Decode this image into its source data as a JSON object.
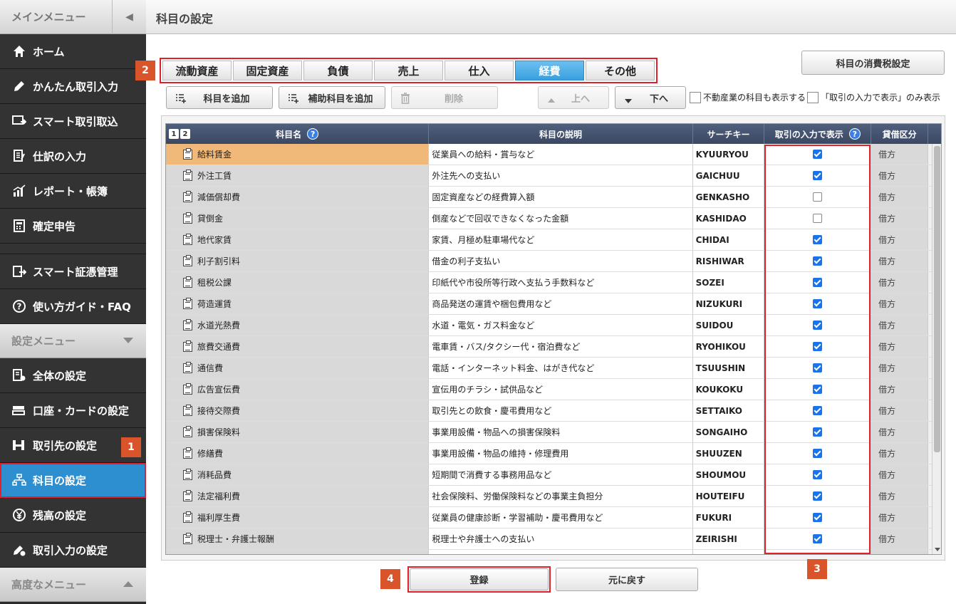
{
  "sidebar": {
    "main_menu_label": "メインメニュー",
    "items": [
      {
        "label": "ホーム",
        "icon": "home-icon"
      },
      {
        "label": "かんたん取引入力",
        "icon": "pencil-icon"
      },
      {
        "label": "スマート取引取込",
        "icon": "import-icon"
      },
      {
        "label": "仕訳の入力",
        "icon": "journal-icon"
      },
      {
        "label": "レポート・帳簿",
        "icon": "chart-icon"
      },
      {
        "label": "確定申告",
        "icon": "tax-return-icon"
      }
    ],
    "items2": [
      {
        "label": "スマート証憑管理",
        "icon": "voucher-icon"
      },
      {
        "label": "使い方ガイド・FAQ",
        "icon": "help-icon"
      }
    ],
    "settings_menu_label": "設定メニュー",
    "settings_items": [
      {
        "label": "全体の設定",
        "icon": "settings-doc-icon"
      },
      {
        "label": "口座・カードの設定",
        "icon": "card-icon"
      },
      {
        "label": "取引先の設定",
        "icon": "partner-icon"
      },
      {
        "label": "科目の設定",
        "icon": "account-tree-icon"
      },
      {
        "label": "残高の設定",
        "icon": "yen-icon"
      },
      {
        "label": "取引入力の設定",
        "icon": "gear-pencil-icon"
      }
    ],
    "advanced_menu_label": "高度なメニュー"
  },
  "header": {
    "title": "科目の設定"
  },
  "badges": {
    "b1": "1",
    "b2": "2",
    "b3": "3",
    "b4": "4"
  },
  "tabs": [
    "流動資産",
    "固定資産",
    "負債",
    "売上",
    "仕入",
    "経費",
    "その他"
  ],
  "active_tab": "経費",
  "toolbar": {
    "tax_settings": "科目の消費税設定",
    "add_account": "科目を追加",
    "add_sub_account": "補助科目を追加",
    "delete": "削除",
    "up": "上へ",
    "down": "下へ",
    "show_real_estate": "不動産業の科目も表示する",
    "show_only_tx": "「取引の入力で表示」のみ表示"
  },
  "table": {
    "headers": {
      "pages": [
        "1",
        "2"
      ],
      "name": "科目名",
      "desc": "科目の説明",
      "key": "サーチキー",
      "show": "取引の入力で表示",
      "type": "貸借区分"
    },
    "rows": [
      {
        "name": "給料賃金",
        "desc": "従業員への給料・賞与など",
        "key": "KYUURYOU",
        "checked": true,
        "type": "借方"
      },
      {
        "name": "外注工賃",
        "desc": "外注先への支払い",
        "key": "GAICHUU",
        "checked": true,
        "type": "借方"
      },
      {
        "name": "減価償却費",
        "desc": "固定資産などの経費算入額",
        "key": "GENKASHO",
        "checked": false,
        "type": "借方"
      },
      {
        "name": "貸倒金",
        "desc": "倒産などで回収できなくなった金額",
        "key": "KASHIDAO",
        "checked": false,
        "type": "借方"
      },
      {
        "name": "地代家賃",
        "desc": "家賃、月極め駐車場代など",
        "key": "CHIDAI",
        "checked": true,
        "type": "借方"
      },
      {
        "name": "利子割引料",
        "desc": "借金の利子支払い",
        "key": "RISHIWAR",
        "checked": true,
        "type": "借方"
      },
      {
        "name": "租税公課",
        "desc": "印紙代や市役所等行政へ支払う手数料など",
        "key": "SOZEI",
        "checked": true,
        "type": "借方"
      },
      {
        "name": "荷造運賃",
        "desc": "商品発送の運賃や梱包費用など",
        "key": "NIZUKURI",
        "checked": true,
        "type": "借方"
      },
      {
        "name": "水道光熱費",
        "desc": "水道・電気・ガス料金など",
        "key": "SUIDOU",
        "checked": true,
        "type": "借方"
      },
      {
        "name": "旅費交通費",
        "desc": "電車賃・バス/タクシー代・宿泊費など",
        "key": "RYOHIKOU",
        "checked": true,
        "type": "借方"
      },
      {
        "name": "通信費",
        "desc": "電話・インターネット料金、はがき代など",
        "key": "TSUUSHIN",
        "checked": true,
        "type": "借方"
      },
      {
        "name": "広告宣伝費",
        "desc": "宣伝用のチラシ・試供品など",
        "key": "KOUKOKU",
        "checked": true,
        "type": "借方"
      },
      {
        "name": "接待交際費",
        "desc": "取引先との飲食・慶弔費用など",
        "key": "SETTAIKO",
        "checked": true,
        "type": "借方"
      },
      {
        "name": "損害保険料",
        "desc": "事業用設備・物品への損害保険料",
        "key": "SONGAIHO",
        "checked": true,
        "type": "借方"
      },
      {
        "name": "修繕費",
        "desc": "事業用設備・物品の維持・修理費用",
        "key": "SHUUZEN",
        "checked": true,
        "type": "借方"
      },
      {
        "name": "消耗品費",
        "desc": "短期間で消費する事務用品など",
        "key": "SHOUMOU",
        "checked": true,
        "type": "借方"
      },
      {
        "name": "法定福利費",
        "desc": "社会保険料、労働保険料などの事業主負担分",
        "key": "HOUTEIFU",
        "checked": true,
        "type": "借方"
      },
      {
        "name": "福利厚生費",
        "desc": "従業員の健康診断・学習補助・慶弔費用など",
        "key": "FUKURI",
        "checked": true,
        "type": "借方"
      },
      {
        "name": "税理士・弁護士報酬",
        "desc": "税理士や弁護士への支払い",
        "key": "ZEIRISHI",
        "checked": true,
        "type": "借方"
      },
      {
        "name": "",
        "desc": "",
        "key": "",
        "checked": false,
        "type": ""
      }
    ]
  },
  "footer": {
    "register": "登録",
    "revert": "元に戻す"
  }
}
